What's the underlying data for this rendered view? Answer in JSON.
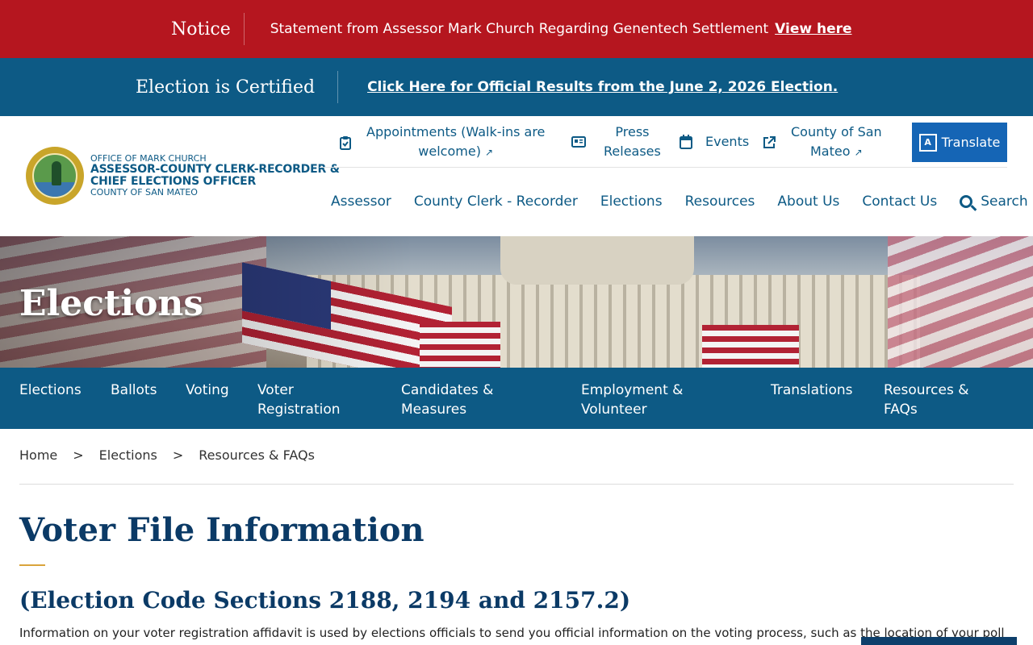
{
  "notice": {
    "label": "Notice",
    "message": "Statement from Assessor Mark Church Regarding Genentech Settlement",
    "link": "View here"
  },
  "certified": {
    "label": "Election is Certified",
    "link": "Click Here for Official Results from the June 2, 2026 Election."
  },
  "logo": {
    "line1": "OFFICE OF MARK CHURCH",
    "line2": "ASSESSOR-COUNTY CLERK-RECORDER &",
    "line3": "CHIEF ELECTIONS OFFICER",
    "line4": "COUNTY OF SAN MATEO"
  },
  "utility": {
    "appointments_line1": "Appointments (Walk-ins are",
    "appointments_line2": "welcome)",
    "press_line1": "Press",
    "press_line2": "Releases",
    "events": "Events",
    "county_line1": "County of San",
    "county_line2": "Mateo",
    "translate": "Translate"
  },
  "main_nav": [
    "Assessor",
    "County Clerk - Recorder",
    "Elections",
    "Resources",
    "About Us",
    "Contact Us"
  ],
  "search_label": "Search",
  "hero": {
    "title": "Elections"
  },
  "sub_nav": {
    "elections": "Elections",
    "ballots": "Ballots",
    "voting": "Voting",
    "voter_reg_1": "Voter",
    "voter_reg_2": "Registration",
    "candidates_1": "Candidates &",
    "candidates_2": "Measures",
    "employment_1": "Employment &",
    "employment_2": "Volunteer",
    "translations": "Translations",
    "resources_1": "Resources &",
    "resources_2": "FAQs"
  },
  "breadcrumb": [
    "Home",
    "Elections",
    "Resources & FAQs"
  ],
  "breadcrumb_sep": ">",
  "page": {
    "title": "Voter File Information",
    "subtitle": "(Election Code Sections 2188, 2194 and 2157.2)",
    "paragraph": "Information on your voter registration affidavit is used by elections officials to send you official information on the voting process, such as the location of your polling place"
  },
  "colors": {
    "notice_red": "#b5161f",
    "brand_blue": "#0d5a85",
    "title_navy": "#0b3a66",
    "accent_gold": "#d9a43b",
    "translate_blue": "#1565b5"
  }
}
